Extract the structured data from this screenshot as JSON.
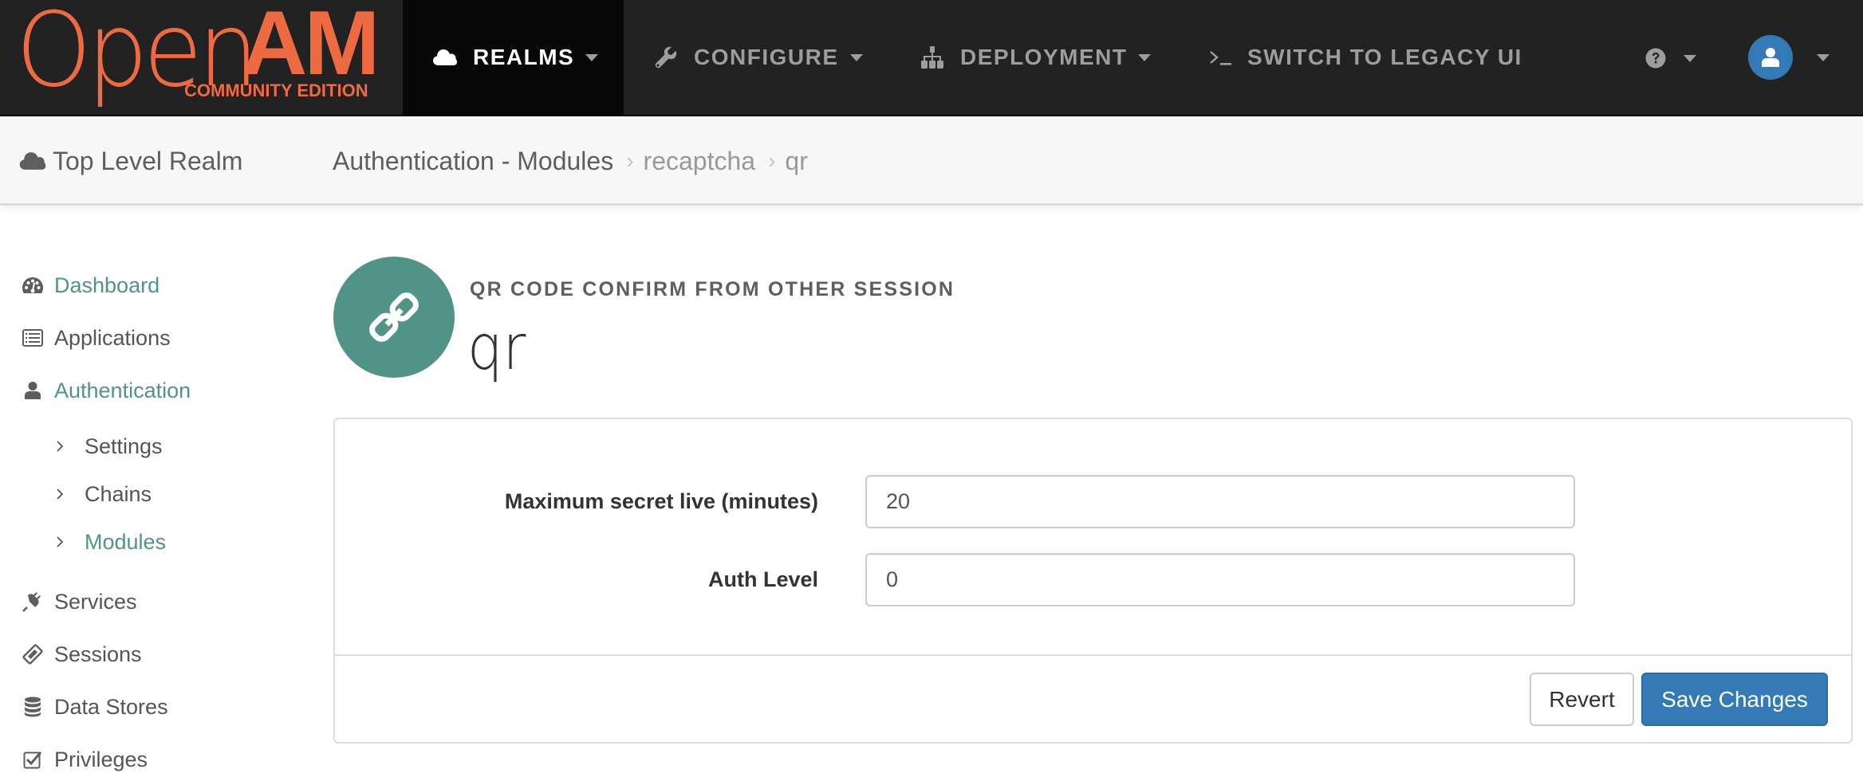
{
  "brand": {
    "name_light": "Open",
    "name_bold": "AM",
    "edition": "COMMUNITY EDITION",
    "color": "#ee6a42"
  },
  "navbar": {
    "items": [
      {
        "label": "REALMS",
        "icon": "cloud-icon",
        "has_dropdown": true,
        "active": true
      },
      {
        "label": "CONFIGURE",
        "icon": "wrench-icon",
        "has_dropdown": true,
        "active": false
      },
      {
        "label": "DEPLOYMENT",
        "icon": "sitemap-icon",
        "has_dropdown": true,
        "active": false
      },
      {
        "label": "SWITCH TO LEGACY UI",
        "icon": "terminal-icon",
        "has_dropdown": false,
        "active": false
      }
    ],
    "help_icon": "question-circle-icon",
    "user_icon": "user-icon",
    "avatar_color": "#337ab7"
  },
  "subbar": {
    "realm": "Top Level Realm",
    "realm_icon": "cloud-icon",
    "breadcrumbs": [
      {
        "label": "Authentication - Modules"
      },
      {
        "label": "recaptcha"
      },
      {
        "label": "qr"
      }
    ],
    "separator": "›"
  },
  "sidebar": {
    "items": [
      {
        "label": "Dashboard",
        "icon": "dashboard-icon",
        "active": true
      },
      {
        "label": "Applications",
        "icon": "list-alt-icon",
        "active": false
      },
      {
        "label": "Authentication",
        "icon": "user-icon",
        "active": true,
        "children": [
          {
            "label": "Settings",
            "active": false
          },
          {
            "label": "Chains",
            "active": false
          },
          {
            "label": "Modules",
            "active": true
          }
        ]
      },
      {
        "label": "Services",
        "icon": "plug-icon",
        "active": false
      },
      {
        "label": "Sessions",
        "icon": "ticket-icon",
        "active": false
      },
      {
        "label": "Data Stores",
        "icon": "database-icon",
        "active": false
      },
      {
        "label": "Privileges",
        "icon": "check-square-icon",
        "active": false
      }
    ],
    "accent_color": "#519487"
  },
  "module": {
    "type_label": "QR CODE CONFIRM FROM OTHER SESSION",
    "name": "qr",
    "icon": "link-icon",
    "icon_bg": "#519487"
  },
  "form": {
    "fields": [
      {
        "label": "Maximum secret live (minutes)",
        "value": "20"
      },
      {
        "label": "Auth Level",
        "value": "0"
      }
    ],
    "buttons": {
      "revert": "Revert",
      "save": "Save Changes"
    },
    "primary_color": "#337ab7"
  }
}
